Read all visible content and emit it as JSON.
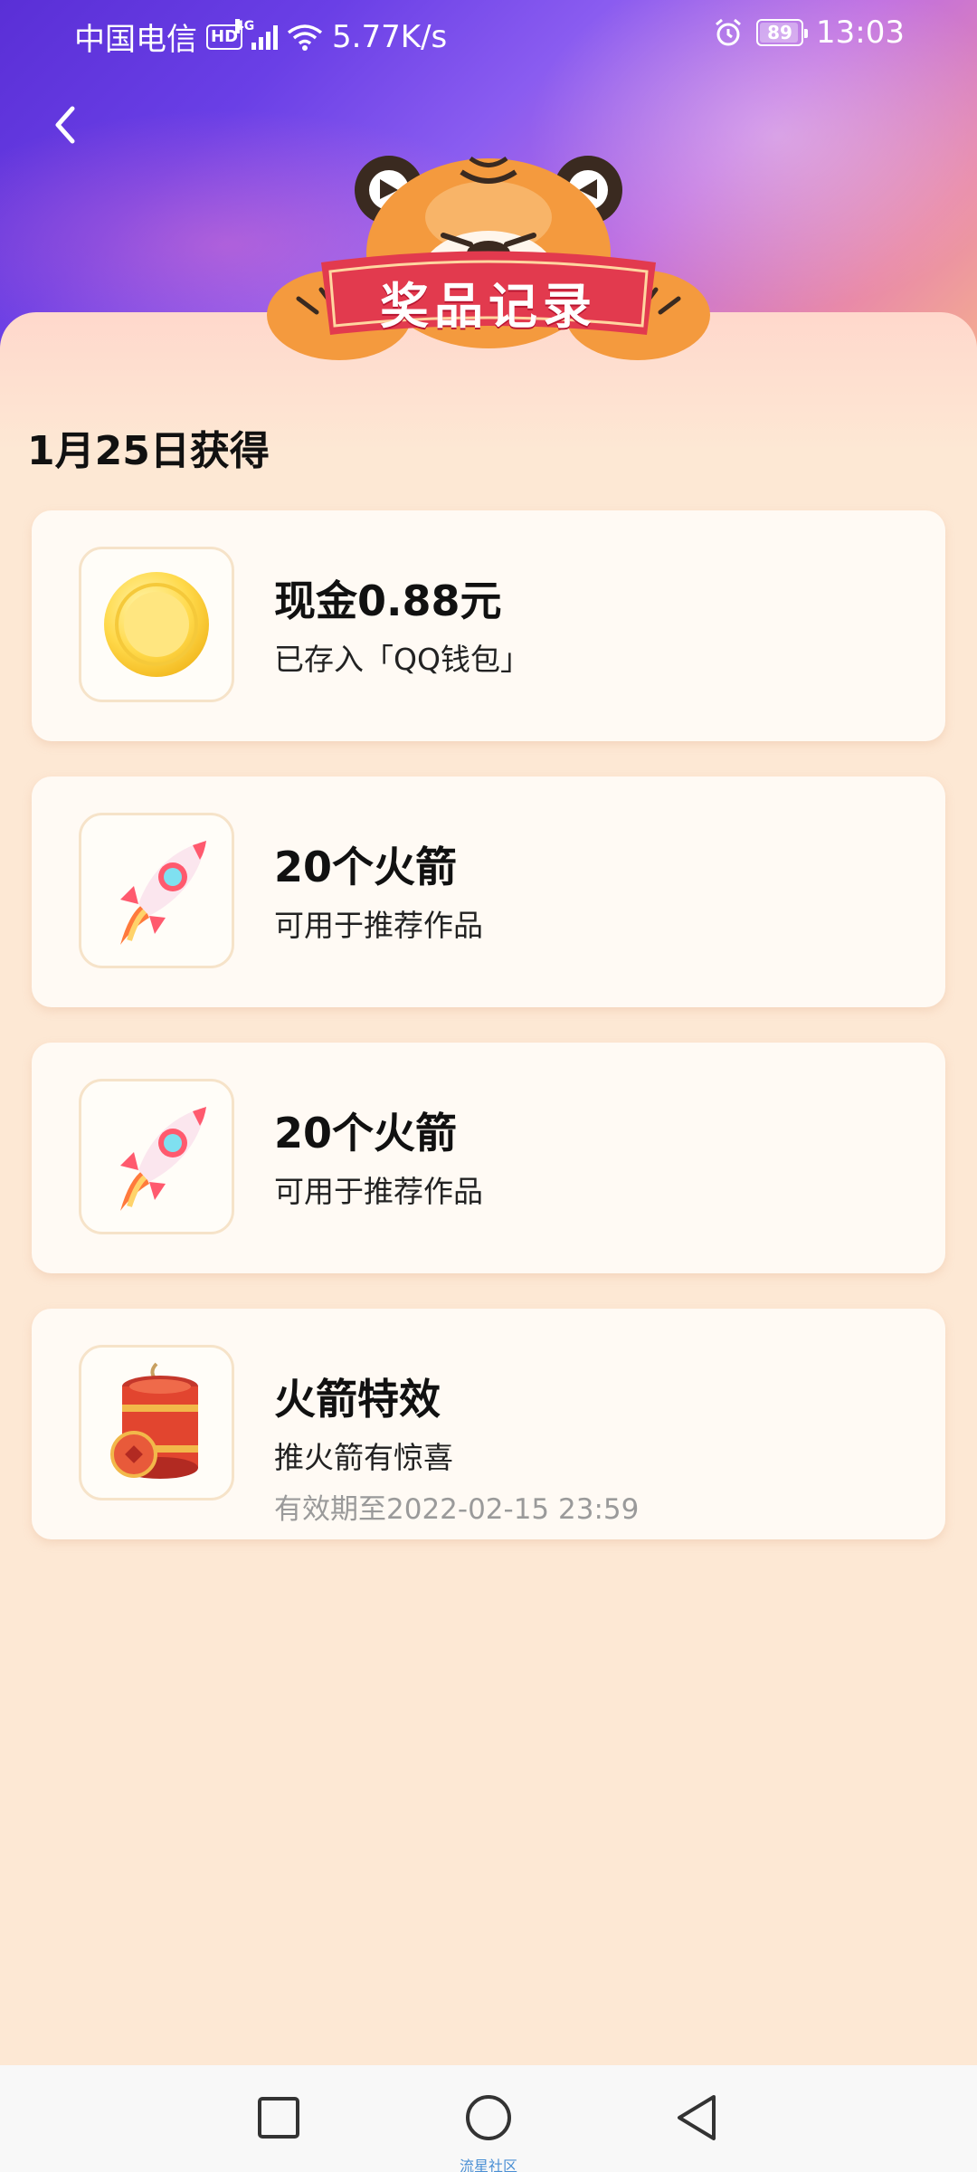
{
  "status_bar": {
    "carrier": "中国电信",
    "hd": "HD",
    "network": "4G",
    "speed": "5.77K/s",
    "battery": "89",
    "time": "13:03"
  },
  "header": {
    "title": "奖品记录"
  },
  "section": {
    "date_heading": "1月25日获得"
  },
  "prizes": [
    {
      "title": "现金0.88元",
      "subtitle": "已存入「QQ钱包」",
      "expiry": "",
      "icon": "gold-coin-icon"
    },
    {
      "title": "20个火箭",
      "subtitle": "可用于推荐作品",
      "expiry": "",
      "icon": "rocket-icon"
    },
    {
      "title": "20个火箭",
      "subtitle": "可用于推荐作品",
      "expiry": "",
      "icon": "rocket-icon"
    },
    {
      "title": "火箭特效",
      "subtitle": "推火箭有惊喜",
      "expiry": "有效期至2022-02-15 23:59",
      "icon": "firecracker-icon"
    }
  ],
  "nav": {
    "caption": "流星社区"
  },
  "colors": {
    "header_start": "#5a2fd6",
    "panel_bg": "#fde8d4",
    "card_bg": "#fffaf4",
    "banner_red": "#e23a4e",
    "expiry_gray": "#9a9a9a"
  }
}
